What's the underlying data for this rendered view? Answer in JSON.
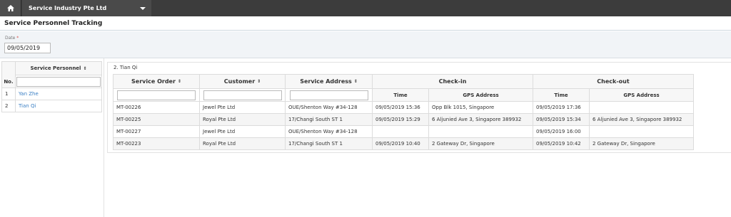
{
  "topbar": {
    "home_icon": "home-icon",
    "company": "Service Industry Pte Ltd"
  },
  "page": {
    "title": "Service Personnel Tracking"
  },
  "filter": {
    "date_label": "Date",
    "required_mark": "*",
    "date_value": "09/05/2019"
  },
  "personnel": {
    "col_no": "No.",
    "col_name": "Service Personnel",
    "rows": [
      {
        "no": "1",
        "name": "Yan Zhe"
      },
      {
        "no": "2",
        "name": "Tian Qi"
      }
    ]
  },
  "orders": {
    "panel_title": "2. Tian Qi",
    "headers": {
      "service_order": "Service Order",
      "customer": "Customer",
      "service_address": "Service Address",
      "checkin": "Check-in",
      "checkout": "Check-out",
      "time": "Time",
      "gps": "GPS Address"
    },
    "rows": [
      {
        "order": "MT-00226",
        "customer": "Jewel Pte Ltd",
        "address": "OUE/Shenton Way #34-128",
        "in_time": "09/05/2019 15:36",
        "in_gps": "Opp Blk 1015, Singapore",
        "out_time": "09/05/2019 17:36",
        "out_gps": ""
      },
      {
        "order": "MT-00225",
        "customer": "Royal Pte Ltd",
        "address": "17/Changi South ST 1",
        "in_time": "09/05/2019 15:29",
        "in_gps": "6 Aljunied Ave 3, Singapore 389932",
        "out_time": "09/05/2019 15:34",
        "out_gps": "6 Aljunied Ave 3, Singapore 389932"
      },
      {
        "order": "MT-00227",
        "customer": "Jewel Pte Ltd",
        "address": "OUE/Shenton Way #34-128",
        "in_time": "",
        "in_gps": "",
        "out_time": "09/05/2019 16:00",
        "out_gps": ""
      },
      {
        "order": "MT-00223",
        "customer": "Royal Pte Ltd",
        "address": "17/Changi South ST 1",
        "in_time": "09/05/2019 10:40",
        "in_gps": "2 Gateway Dr, Singapore",
        "out_time": "09/05/2019 10:42",
        "out_gps": "2 Gateway Dr, Singapore"
      }
    ]
  },
  "colors": {
    "topbar": "#3c3c3c",
    "link": "#3a7fc4",
    "filter_bg": "#f1f4f7",
    "required": "#d9534f"
  }
}
